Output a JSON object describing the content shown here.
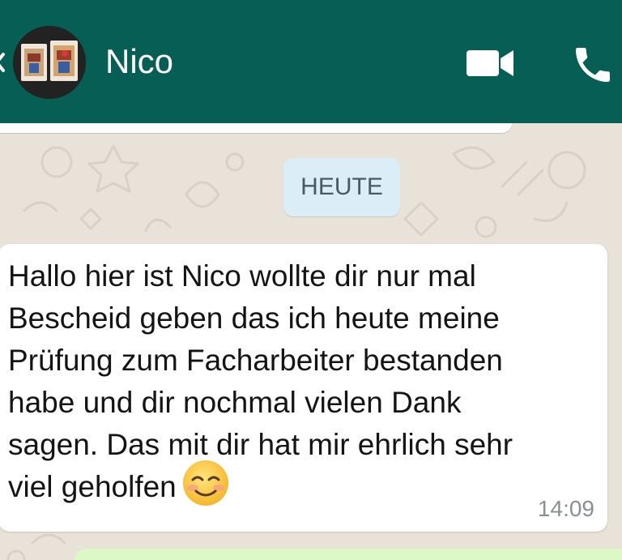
{
  "header": {
    "contact_name": "Nico",
    "back_icon": "arrow-left-icon",
    "video_icon": "video-camera-icon",
    "call_icon": "phone-icon",
    "color": "#075e54"
  },
  "chat": {
    "date_divider": "HEUTE",
    "messages": [
      {
        "direction": "incoming",
        "text": "Hallo hier ist Nico wollte dir nur mal\nBescheid geben das ich heute meine\nPrüfung zum Facharbeiter bestanden\nhabe und dir nochmal vielen Dank\nsagen. Das mit dir hat mir ehrlich sehr\nviel geholfen",
        "emoji": "smiling-face-with-smiling-eyes-icon",
        "time": "14:09"
      }
    ]
  },
  "colors": {
    "wallpaper": "#e9e2d8",
    "incoming_bubble": "#ffffff",
    "outgoing_bubble": "#dcf8c6",
    "date_chip": "#dbeef7"
  }
}
